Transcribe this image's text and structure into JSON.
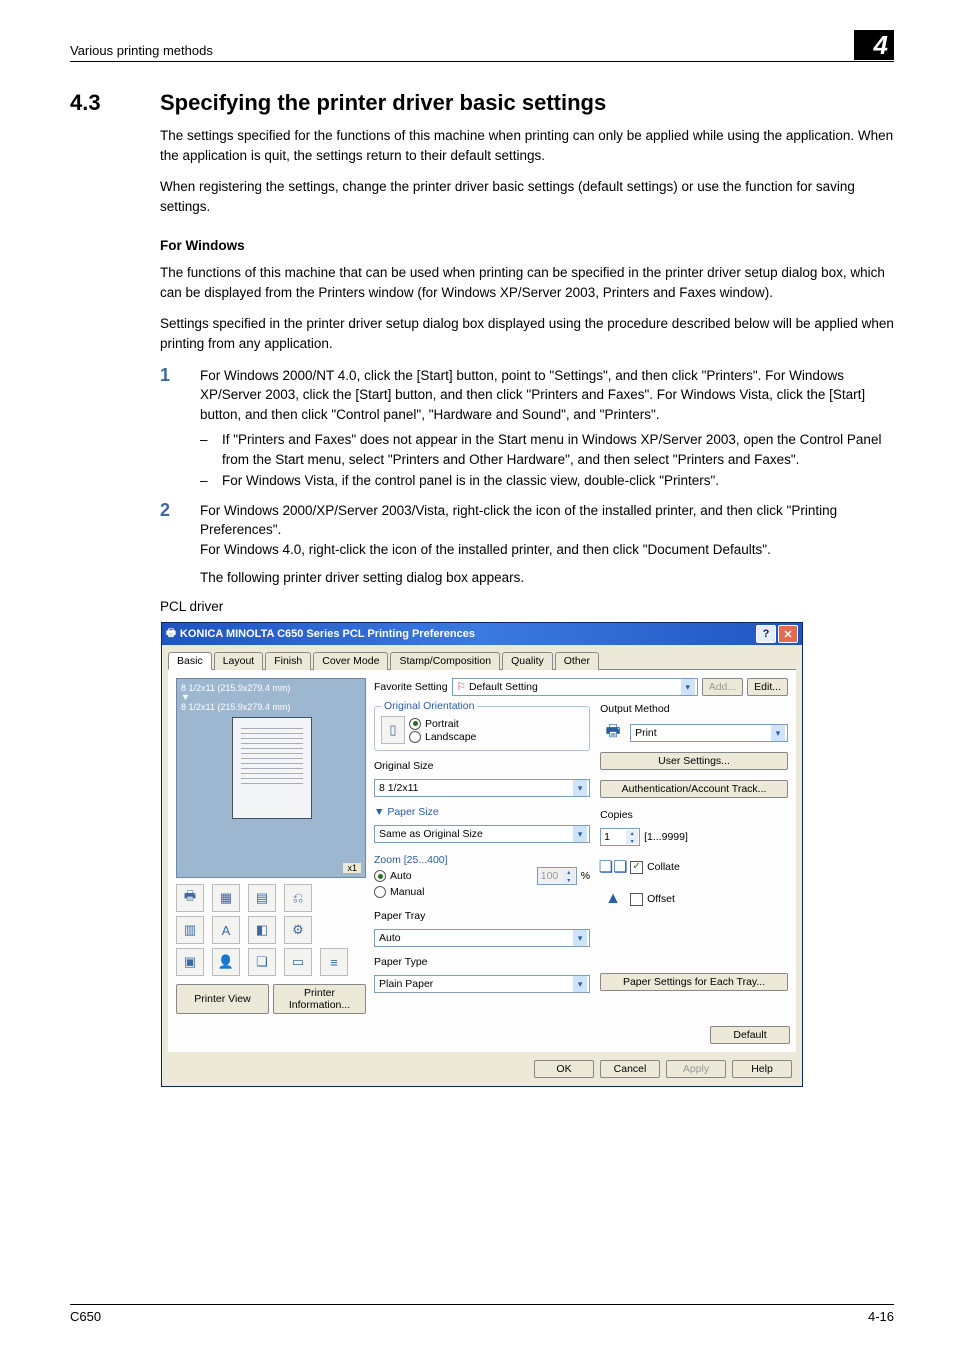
{
  "header": {
    "running_head": "Various printing methods",
    "chapter_number": "4"
  },
  "section": {
    "number": "4.3",
    "title": "Specifying the printer driver basic settings",
    "intro1": "The settings specified for the functions of this machine when printing can only be applied while using the application. When the application is quit, the settings return to their default settings.",
    "intro2": "When registering the settings, change the printer driver basic settings (default settings) or use the function for saving settings.",
    "sub_head": "For Windows",
    "win_para1": "The functions of this machine that can be used when printing can be specified in the printer driver setup dialog box, which can be displayed from the Printers window (for Windows XP/Server 2003, Printers and Faxes window).",
    "win_para2": "Settings specified in the printer driver setup dialog box displayed using the procedure described below will be applied when printing from any application.",
    "step1_body": "For Windows 2000/NT 4.0, click the [Start] button, point to \"Settings\", and then click \"Printers\". For Windows XP/Server 2003, click the [Start] button, and then click \"Printers and Faxes\". For Windows Vista, click the [Start] button, and then click \"Control panel\", \"Hardware and Sound\", and \"Printers\".",
    "step1_dash1": "If \"Printers and Faxes\" does not appear in the Start menu in Windows XP/Server 2003, open the Control Panel from the Start menu, select \"Printers and Other Hardware\", and then select \"Printers and Faxes\".",
    "step1_dash2": "For Windows Vista, if the control panel is in the classic view, double-click \"Printers\".",
    "step2_body": "For Windows 2000/XP/Server 2003/Vista, right-click the icon of the installed printer, and then click \"Printing Preferences\".\nFor Windows 4.0, right-click the icon of the installed printer, and then click \"Document Defaults\".",
    "after_steps": "The following printer driver setting dialog box appears.",
    "pcl_label": "PCL driver"
  },
  "dialog": {
    "title": "KONICA MINOLTA C650 Series PCL Printing Preferences",
    "tabs": [
      "Basic",
      "Layout",
      "Finish",
      "Cover Mode",
      "Stamp/Composition",
      "Quality",
      "Other"
    ],
    "preview_line1": "8 1/2x11 (215.9x279.4 mm)",
    "preview_line2": "8 1/2x11 (215.9x279.4 mm)",
    "x1": "x1",
    "printer_view": "Printer View",
    "printer_info": "Printer Information...",
    "favorite_label": "Favorite Setting",
    "favorite_value": "Default Setting",
    "add_btn": "Add...",
    "edit_btn": "Edit...",
    "orientation_legend": "Original Orientation",
    "portrait": "Portrait",
    "landscape": "Landscape",
    "original_size_lbl": "Original Size",
    "original_size_val": "8 1/2x11",
    "paper_size_lbl": "Paper Size",
    "paper_size_val": "Same as Original Size",
    "zoom_legend": "Zoom [25...400]",
    "auto": "Auto",
    "manual": "Manual",
    "zoom_val": "100",
    "pct": "%",
    "paper_tray_lbl": "Paper Tray",
    "paper_tray_val": "Auto",
    "paper_type_lbl": "Paper Type",
    "paper_type_val": "Plain Paper",
    "output_method_lbl": "Output Method",
    "output_method_val": "Print",
    "user_settings_btn": "User Settings...",
    "auth_btn": "Authentication/Account Track...",
    "copies_lbl": "Copies",
    "copies_val": "1",
    "copies_range": "[1...9999]",
    "collate": "Collate",
    "offset": "Offset",
    "paper_settings_btn": "Paper Settings for Each Tray...",
    "default_btn": "Default",
    "ok": "OK",
    "cancel": "Cancel",
    "apply": "Apply",
    "help": "Help"
  },
  "footer": {
    "left": "C650",
    "right": "4-16"
  }
}
